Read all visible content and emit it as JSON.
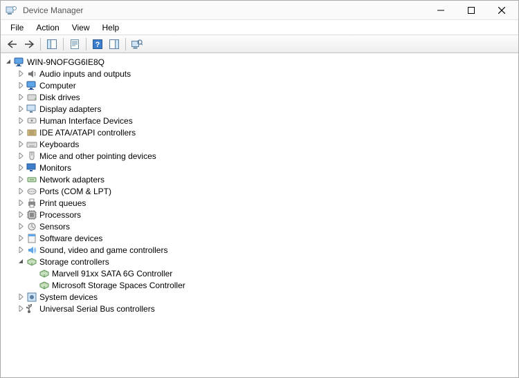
{
  "window": {
    "title": "Device Manager"
  },
  "controls": {
    "minimize": "Minimize",
    "maximize": "Maximize",
    "close": "Close"
  },
  "menu": {
    "items": [
      "File",
      "Action",
      "View",
      "Help"
    ]
  },
  "toolbar": {
    "back": "Back",
    "forward": "Forward",
    "show_hide_tree": "Show/Hide Console Tree",
    "properties": "Properties",
    "help": "Help",
    "show_hide_action": "Show/Hide Action Pane",
    "scan": "Scan for hardware changes"
  },
  "tree": {
    "root": {
      "label": "WIN-9NOFGG6IE8Q",
      "icon": "computer"
    },
    "categories": [
      {
        "label": "Audio inputs and outputs",
        "icon": "audio",
        "expanded": false
      },
      {
        "label": "Computer",
        "icon": "computer",
        "expanded": false
      },
      {
        "label": "Disk drives",
        "icon": "disk",
        "expanded": false
      },
      {
        "label": "Display adapters",
        "icon": "display",
        "expanded": false
      },
      {
        "label": "Human Interface Devices",
        "icon": "hid",
        "expanded": false
      },
      {
        "label": "IDE ATA/ATAPI controllers",
        "icon": "ide",
        "expanded": false
      },
      {
        "label": "Keyboards",
        "icon": "keyboard",
        "expanded": false
      },
      {
        "label": "Mice and other pointing devices",
        "icon": "mouse",
        "expanded": false
      },
      {
        "label": "Monitors",
        "icon": "monitor",
        "expanded": false
      },
      {
        "label": "Network adapters",
        "icon": "network",
        "expanded": false
      },
      {
        "label": "Ports (COM & LPT)",
        "icon": "port",
        "expanded": false
      },
      {
        "label": "Print queues",
        "icon": "printer",
        "expanded": false
      },
      {
        "label": "Processors",
        "icon": "cpu",
        "expanded": false
      },
      {
        "label": "Sensors",
        "icon": "sensor",
        "expanded": false
      },
      {
        "label": "Software devices",
        "icon": "software",
        "expanded": false
      },
      {
        "label": "Sound, video and game controllers",
        "icon": "sound",
        "expanded": false
      },
      {
        "label": "Storage controllers",
        "icon": "storage",
        "expanded": true,
        "children": [
          {
            "label": "Marvell 91xx SATA 6G Controller",
            "icon": "storage"
          },
          {
            "label": "Microsoft Storage Spaces Controller",
            "icon": "storage"
          }
        ]
      },
      {
        "label": "System devices",
        "icon": "system",
        "expanded": false
      },
      {
        "label": "Universal Serial Bus controllers",
        "icon": "usb",
        "expanded": false
      }
    ]
  }
}
